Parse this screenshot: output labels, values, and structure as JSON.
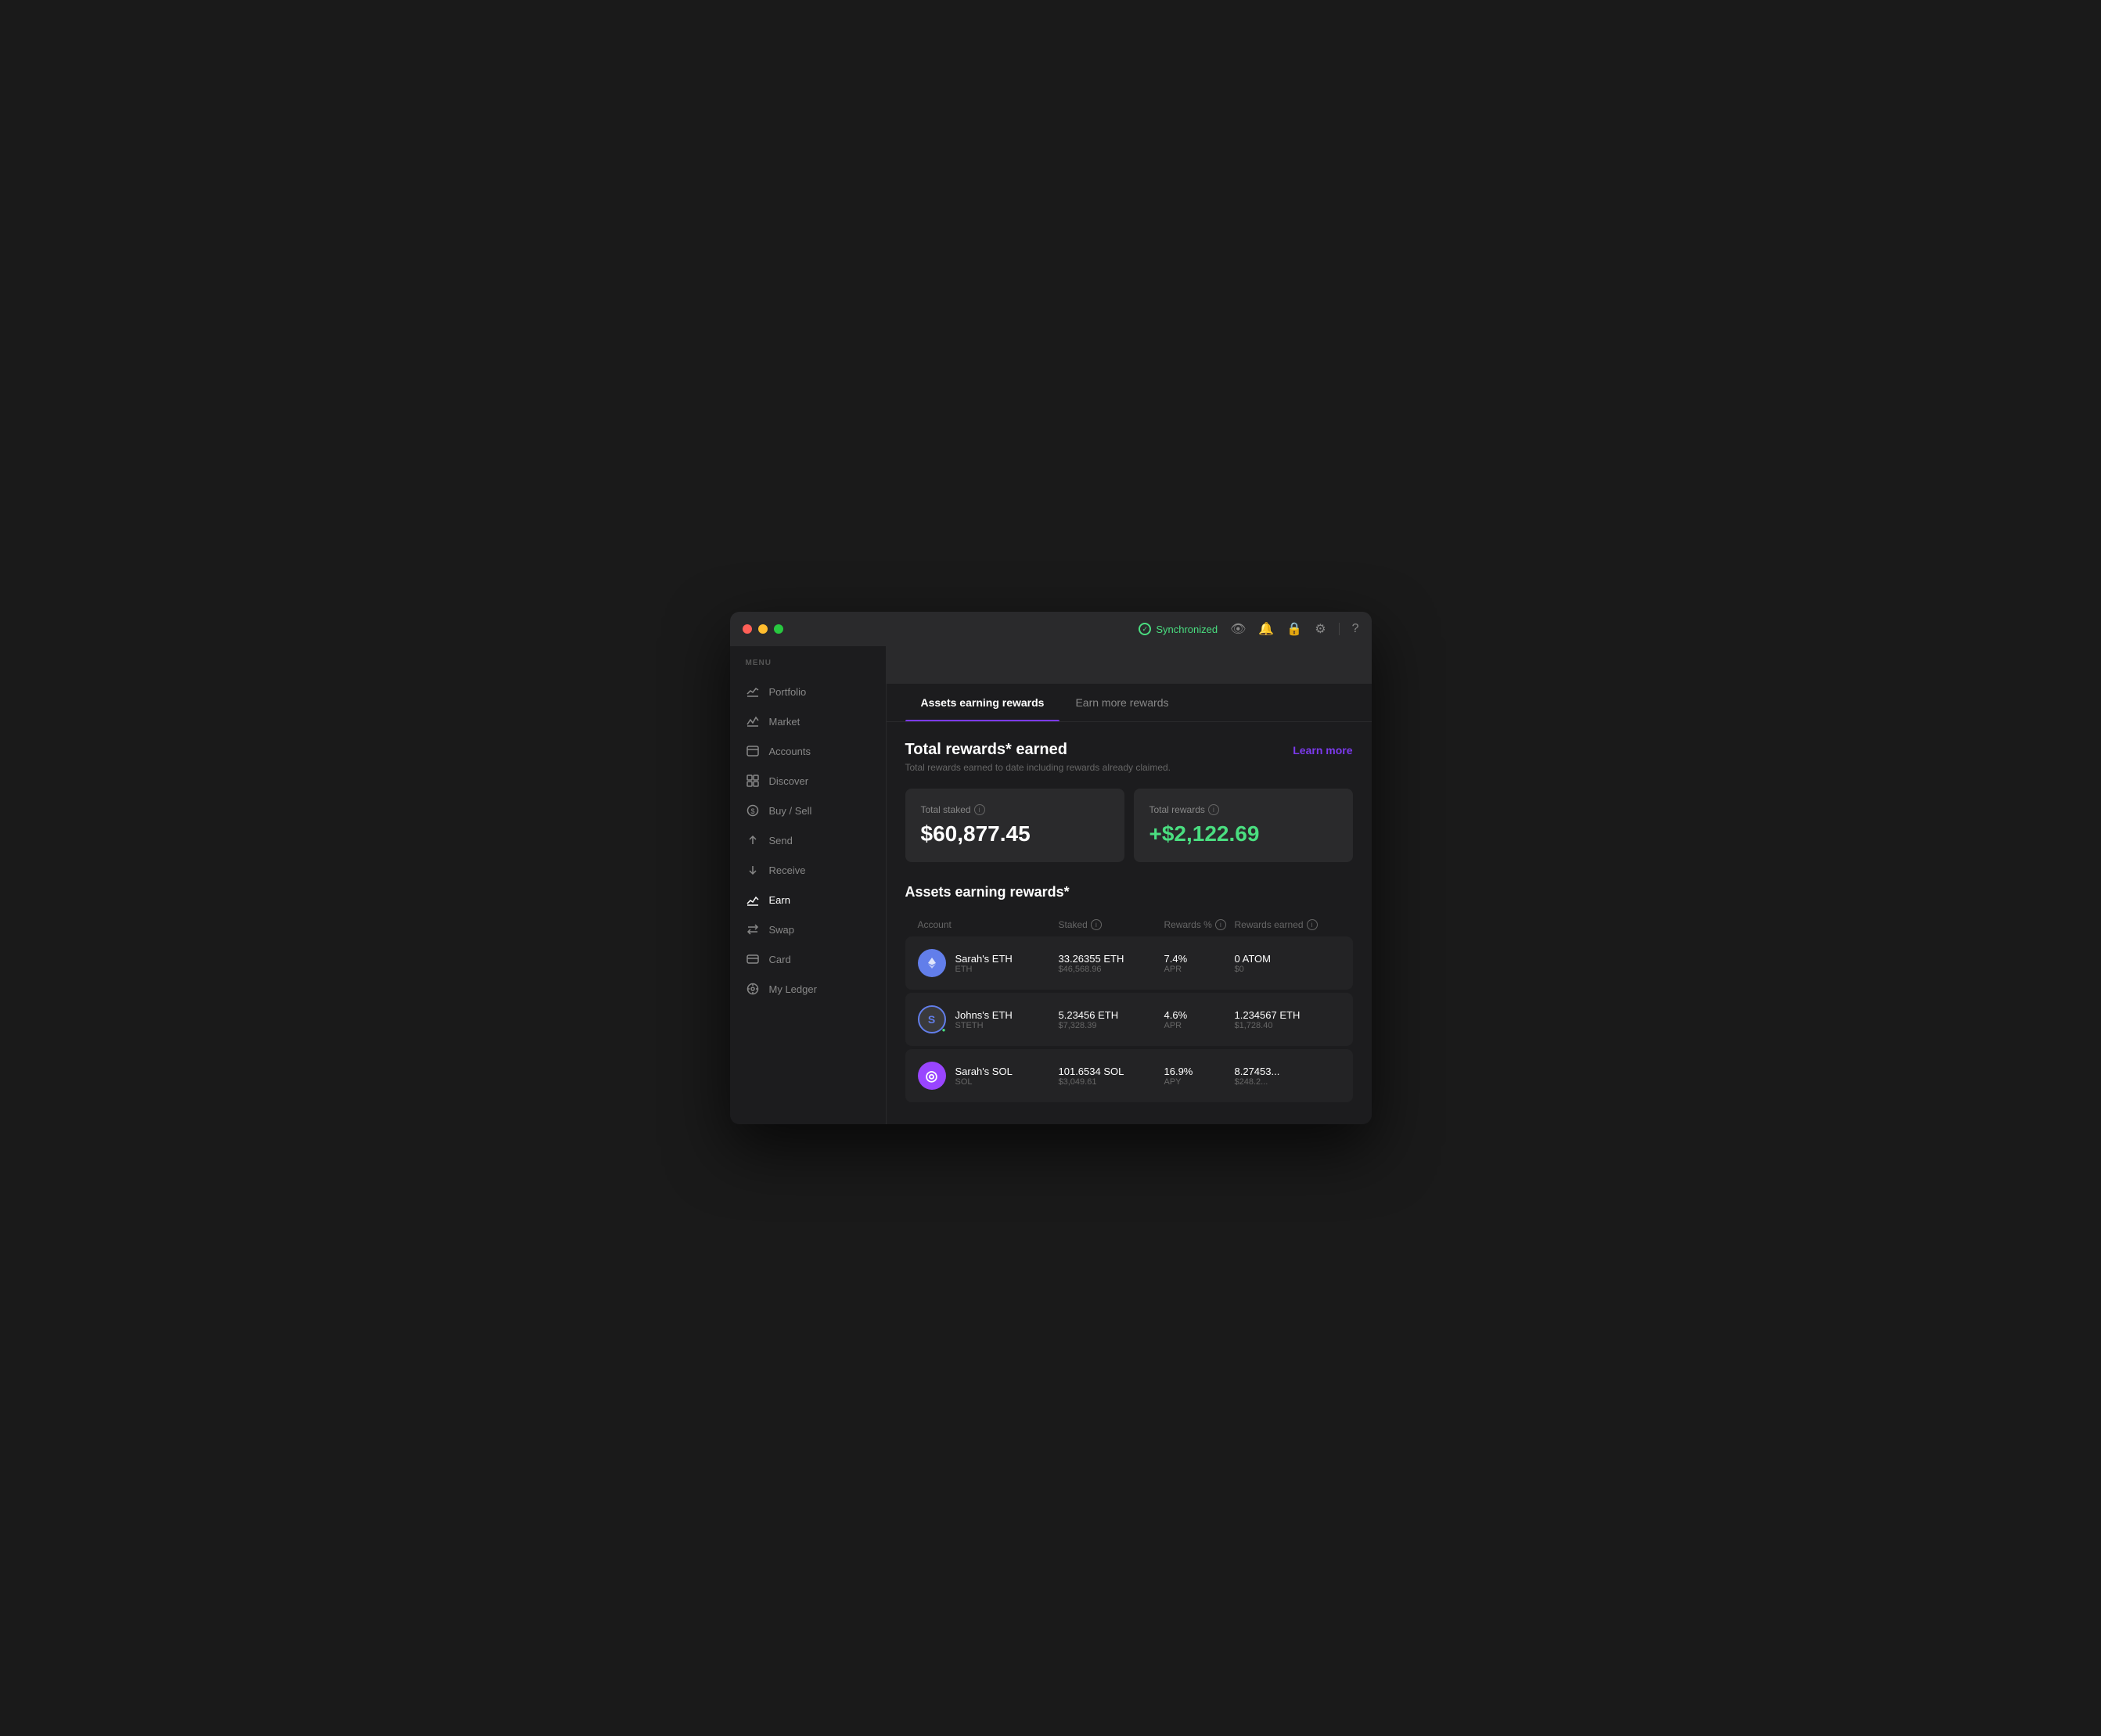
{
  "window": {
    "traffic_lights": [
      "red",
      "yellow",
      "green"
    ]
  },
  "titlebar": {
    "sync_status": "Synchronized",
    "icons": [
      "eye",
      "bell",
      "lock",
      "gear",
      "divider",
      "question"
    ]
  },
  "sidebar": {
    "menu_label": "MENU",
    "items": [
      {
        "id": "portfolio",
        "label": "Portfolio",
        "icon": "📊"
      },
      {
        "id": "market",
        "label": "Market",
        "icon": "📈"
      },
      {
        "id": "accounts",
        "label": "Accounts",
        "icon": "🗂"
      },
      {
        "id": "discover",
        "label": "Discover",
        "icon": "⊞"
      },
      {
        "id": "buy-sell",
        "label": "Buy / Sell",
        "icon": "💲"
      },
      {
        "id": "send",
        "label": "Send",
        "icon": "↑"
      },
      {
        "id": "receive",
        "label": "Receive",
        "icon": "↓"
      },
      {
        "id": "earn",
        "label": "Earn",
        "icon": "📉"
      },
      {
        "id": "swap",
        "label": "Swap",
        "icon": "↔"
      },
      {
        "id": "card",
        "label": "Card",
        "icon": "💳"
      },
      {
        "id": "my-ledger",
        "label": "My Ledger",
        "icon": "⚙"
      }
    ]
  },
  "tabs": [
    {
      "id": "assets-earning",
      "label": "Assets earning rewards",
      "active": true
    },
    {
      "id": "earn-more",
      "label": "Earn more rewards",
      "active": false
    }
  ],
  "rewards_section": {
    "title": "Total rewards* earned",
    "subtitle": "Total rewards earned to date including rewards already claimed.",
    "learn_more": "Learn more",
    "total_staked_label": "Total staked",
    "total_staked_value": "$60,877.45",
    "total_rewards_label": "Total rewards",
    "total_rewards_value": "+$2,122.69"
  },
  "assets_table": {
    "section_title": "Assets earning rewards*",
    "columns": [
      "Account",
      "Staked",
      "Rewards %",
      "Rewards earned"
    ],
    "rows": [
      {
        "account_name": "Sarah's ETH",
        "account_ticker": "ETH",
        "icon_type": "eth",
        "icon_symbol": "⬟",
        "staked_amount": "33.26355 ETH",
        "staked_usd": "$46,568.96",
        "rewards_pct": "7.4%",
        "rewards_type": "APR",
        "rewards_earned": "0 ATOM",
        "rewards_earned_usd": "$0"
      },
      {
        "account_name": "Johns's ETH",
        "account_ticker": "STETH",
        "icon_type": "steth",
        "icon_symbol": "S",
        "staked_amount": "5.23456 ETH",
        "staked_usd": "$7,328.39",
        "rewards_pct": "4.6%",
        "rewards_type": "APR",
        "rewards_earned": "1.234567 ETH",
        "rewards_earned_usd": "$1,728.40"
      },
      {
        "account_name": "Sarah's SOL",
        "account_ticker": "SOL",
        "icon_type": "sol",
        "icon_symbol": "◎",
        "staked_amount": "101.6534 SOL",
        "staked_usd": "$3,049.61",
        "rewards_pct": "16.9%",
        "rewards_type": "APY",
        "rewards_earned": "8.27453...",
        "rewards_earned_usd": "$248.2..."
      }
    ]
  }
}
